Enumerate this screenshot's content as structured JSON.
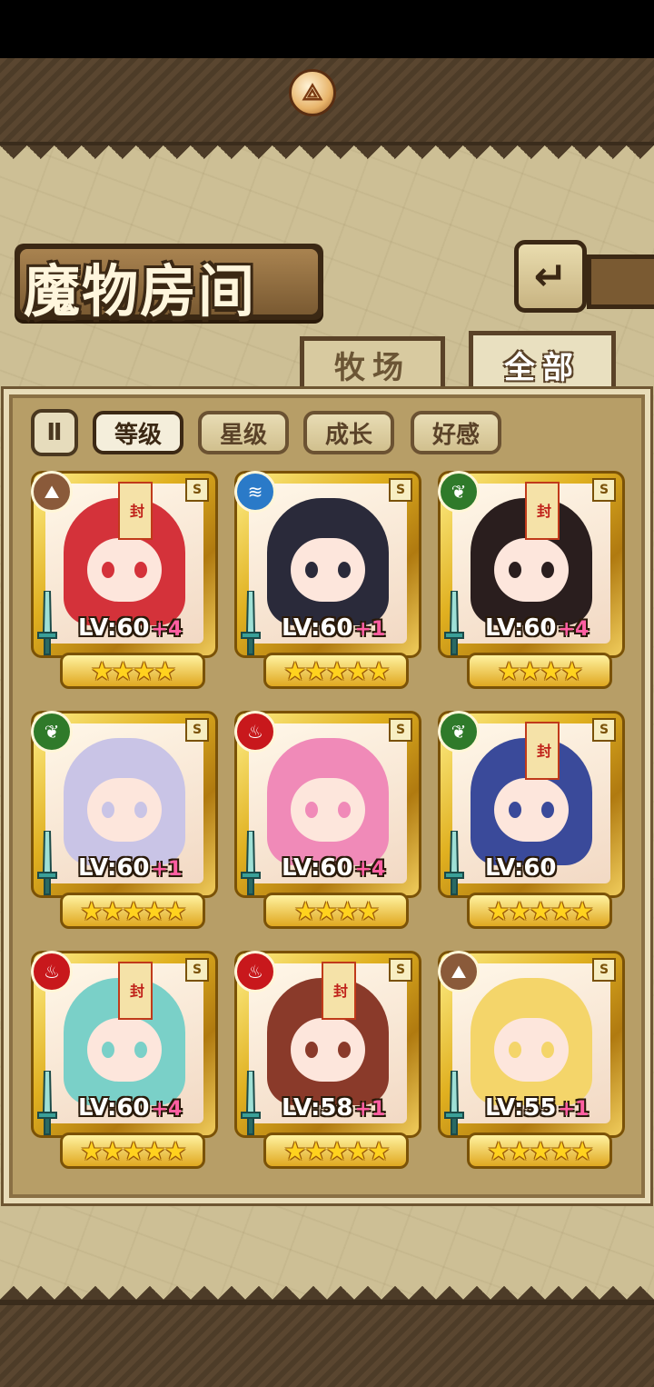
{
  "header": {
    "title": "魔物房间",
    "compass_icon": "compass-icon",
    "back_icon": "return-arrow-icon"
  },
  "tabs": [
    {
      "label": "牧场",
      "active": false
    },
    {
      "label": "全部",
      "active": true
    }
  ],
  "sort_toggle": {
    "icon": "sort-order-icon",
    "label": "Ⅱ"
  },
  "filters": [
    {
      "label": "等级",
      "active": true
    },
    {
      "label": "星级",
      "active": false
    },
    {
      "label": "成长",
      "active": false
    },
    {
      "label": "好感",
      "active": false
    }
  ],
  "monsters": [
    {
      "element": "earth",
      "level": "LV:60",
      "bonus": "+4",
      "stars": "★★★★",
      "sealed": true,
      "seal_text": "封",
      "color": "#d4323a"
    },
    {
      "element": "water",
      "level": "LV:60",
      "bonus": "+1",
      "stars": "★★★★★",
      "sealed": false,
      "color": "#2a2a3a"
    },
    {
      "element": "wood",
      "level": "LV:60",
      "bonus": "+4",
      "stars": "★★★★",
      "sealed": true,
      "seal_text": "封",
      "color": "#2a1e1e"
    },
    {
      "element": "wood",
      "level": "LV:60",
      "bonus": "+1",
      "stars": "★★★★★",
      "sealed": false,
      "color": "#c9c4e6"
    },
    {
      "element": "fire",
      "level": "LV:60",
      "bonus": "+4",
      "stars": "★★★★",
      "sealed": false,
      "color": "#f08ab8"
    },
    {
      "element": "wood",
      "level": "LV:60",
      "bonus": "",
      "stars": "★★★★★",
      "sealed": true,
      "seal_text": "封",
      "color": "#3a4a9a"
    },
    {
      "element": "fire",
      "level": "LV:60",
      "bonus": "+4",
      "stars": "★★★★★",
      "sealed": true,
      "seal_text": "封",
      "color": "#7ad0c8"
    },
    {
      "element": "fire",
      "level": "LV:58",
      "bonus": "+1",
      "stars": "★★★★★",
      "sealed": true,
      "seal_text": "封",
      "color": "#8a3a2a"
    },
    {
      "element": "earth",
      "level": "LV:55",
      "bonus": "+1",
      "stars": "★★★★★",
      "sealed": false,
      "color": "#f4d56a"
    }
  ],
  "element_colors": {
    "earth": "#8a5a3a",
    "water": "#2a7ac8",
    "wood": "#2f7a2a",
    "fire": "#c8181c"
  },
  "element_icons": {
    "earth": "⛰",
    "water": "≋",
    "wood": "❦",
    "fire": "♨"
  }
}
